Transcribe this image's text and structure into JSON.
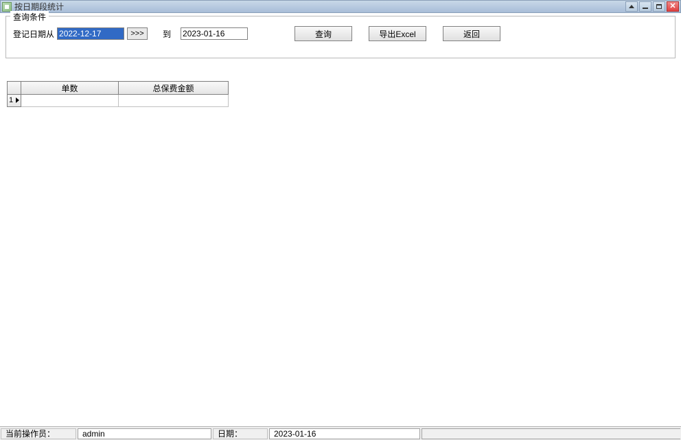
{
  "window": {
    "title": "按日期段统计"
  },
  "query": {
    "panel_title": "查询条件",
    "date_from_label": "登记日期从",
    "date_from_value": "2022-12-17",
    "date_picker_btn": ">>>",
    "to_label": "到",
    "date_to_value": "2023-01-16",
    "search_btn": "查询",
    "export_btn": "导出Excel",
    "back_btn": "返回"
  },
  "grid": {
    "columns": [
      "单数",
      "总保费金额"
    ],
    "rows": [
      {
        "num": "1",
        "c1": "",
        "c2": ""
      }
    ]
  },
  "status": {
    "operator_label": "当前操作员：",
    "operator_value": "admin",
    "date_label": "日期：",
    "date_value": "2023-01-16"
  }
}
